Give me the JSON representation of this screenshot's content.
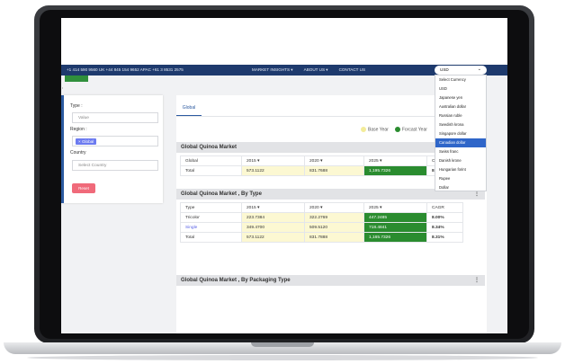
{
  "topbar": {
    "contacts": "+1 414 590 9560  UK +44 845 154 9652  APAC +61 3 8531 2575",
    "nav": [
      "MARKET INSIGHTS ▾",
      "ABOUT US ▾",
      "CONTACT US"
    ],
    "currency_value": "USD"
  },
  "currency_options": [
    "Select Currency",
    "USD",
    "Japanese yen",
    "Australian dollar",
    "Russian ruble",
    "Swedish krona",
    "Singapore dollar",
    "Canadian dollar",
    "Swiss franc",
    "Danish krone",
    "Hungarian forint",
    "Rupee",
    "Dollar"
  ],
  "currency_selected_index": 7,
  "filters": {
    "type_label": "Type :",
    "type_value": "Value",
    "region_label": "Region :",
    "region_chip": "× Global",
    "country_label": "Country",
    "country_placeholder": "Select Country",
    "reset_label": "Reset"
  },
  "tab_label": "Global",
  "legend": {
    "base": "Base Year",
    "forecast": "Forcast Year"
  },
  "colors": {
    "accent": "#1e3a6d",
    "forecast_green": "#2a8c2f",
    "base_yellow": "#fcf8d2",
    "selected_blue": "#2f66c9"
  },
  "sections": [
    {
      "title": "Global Quinoa Market",
      "header": [
        "Global",
        "2015 ▾",
        "2020 ▾",
        "2025 ▾",
        "CAGR"
      ],
      "rows": [
        [
          "Total",
          "573.1122",
          "831.7688",
          "1,195.7326",
          "8.31%"
        ]
      ]
    },
    {
      "title": "Global Quinoa Market , By Type",
      "header": [
        "Type",
        "2015 ▾",
        "2020 ▾",
        "2025 ▾",
        "CAGR"
      ],
      "rows": [
        [
          "Tricolor",
          "223.7384",
          "322.2769",
          "447.2485",
          "8.00%"
        ],
        [
          "Single",
          "349.4700",
          "509.5120",
          "718.4841",
          "8.34%"
        ],
        [
          "Total",
          "573.1122",
          "831.7888",
          "1,165.7326",
          "8.31%"
        ]
      ]
    },
    {
      "title": "Global Quinoa Market , By Packaging Type"
    }
  ]
}
